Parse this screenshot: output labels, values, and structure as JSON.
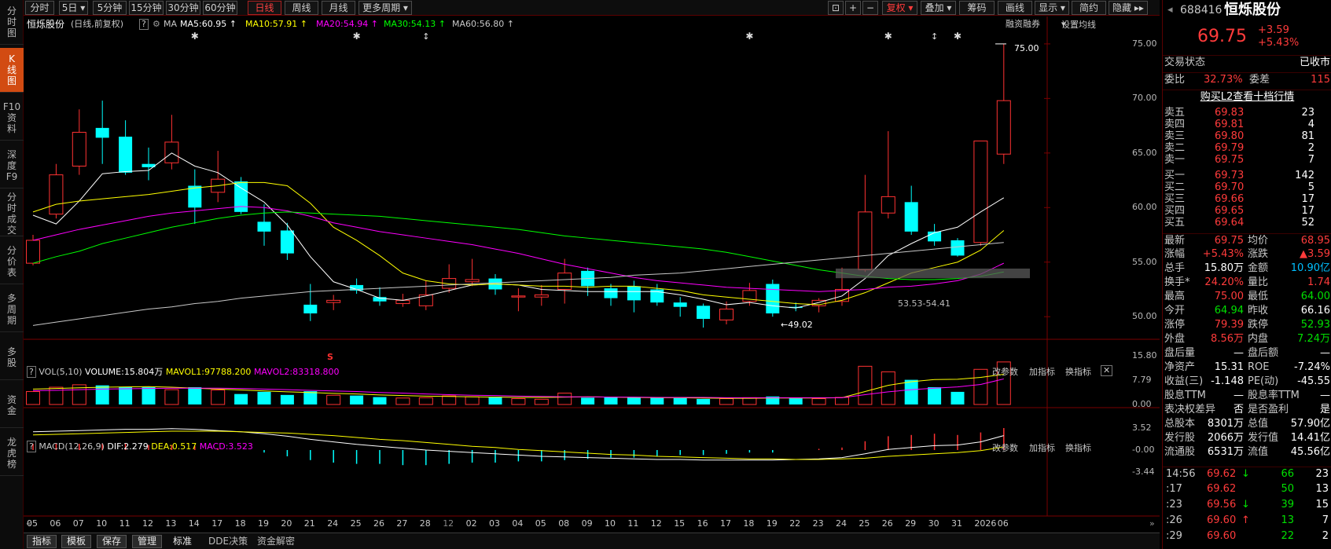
{
  "left_nav": [
    {
      "label": "分时图"
    },
    {
      "label": "K线图",
      "active": true
    },
    {
      "label": "F10资料"
    },
    {
      "label": "深度F9"
    },
    {
      "label": "分时成交"
    },
    {
      "label": "分价表"
    },
    {
      "label": "多周期"
    },
    {
      "label": "多股"
    },
    {
      "label": "资金"
    },
    {
      "label": "龙虎榜"
    }
  ],
  "toolbar": {
    "periods": [
      "分时",
      "5日",
      "5分钟",
      "15分钟",
      "30分钟",
      "60分钟",
      "日线",
      "周线",
      "月线",
      "更多周期"
    ],
    "active_period": "日线",
    "right_buttons": [
      "复权",
      "叠加",
      "筹码",
      "画线",
      "显示",
      "简约",
      "隐藏"
    ]
  },
  "title_bar": {
    "stock_name": "恒烁股份",
    "mode": "(日线,前复权)",
    "help": "?",
    "ma_label": "MA",
    "ma": [
      {
        "label": "MA5:60.95",
        "color": "#ffffff"
      },
      {
        "label": "MA10:57.91",
        "color": "#ffff00"
      },
      {
        "label": "MA20:54.94",
        "color": "#ff00ff"
      },
      {
        "label": "MA30:54.13",
        "color": "#00ff00"
      },
      {
        "label": "MA60:56.80",
        "color": "#c8c8c8"
      }
    ],
    "right_links": [
      "融资融券",
      "设置均线"
    ]
  },
  "price_axis": [
    "75.00",
    "70.00",
    "65.00",
    "60.00",
    "55.00",
    "50.00"
  ],
  "annotations": {
    "high": "75.00",
    "low": "49.02",
    "zone": "53.53-54.41",
    "s_marker": "S"
  },
  "vol_panel": {
    "title": "VOL(5,10)",
    "volume": "VOLUME:15.804万",
    "mavol1": "MAVOL1:97788.200",
    "mavol2": "MAVOL2:83318.800",
    "links": [
      "改参数",
      "加指标",
      "换指标"
    ],
    "axis": [
      "15.80",
      "7.79",
      "0.00"
    ]
  },
  "macd_panel": {
    "title": "MACD(12,26,9)",
    "dif": "DIF:2.279",
    "dea": "DEA:0.517",
    "macd": "MACD:3.523",
    "links": [
      "改参数",
      "加指标",
      "换指标"
    ],
    "axis": [
      "3.52",
      "-0.00",
      "-3.44"
    ]
  },
  "x_labels": [
    "05",
    "06",
    "07",
    "10",
    "11",
    "12",
    "13",
    "14",
    "17",
    "18",
    "19",
    "20",
    "21",
    "24",
    "25",
    "26",
    "27",
    "28",
    "12",
    "02",
    "03",
    "04",
    "05",
    "08",
    "09",
    "10",
    "11",
    "12",
    "15",
    "16",
    "17",
    "18",
    "19",
    "22",
    "23",
    "24",
    "25",
    "26",
    "29",
    "30",
    "31",
    "2026",
    "06"
  ],
  "bottom_tabs": [
    "指标",
    "模板",
    "保存",
    "管理",
    "标准",
    "DDE决策",
    "资金解密"
  ],
  "quote": {
    "code": "688416",
    "name": "恒烁股份",
    "price": "69.75",
    "change": "+3.59",
    "pct": "+5.43%",
    "status_label": "交易状态",
    "status": "已收市",
    "wei_bi_label": "委比",
    "wei_bi": "32.73%",
    "wei_cha_label": "委差",
    "wei_cha": "115",
    "l2_link": "购买L2查看十档行情",
    "asks": [
      {
        "label": "卖五",
        "price": "69.83",
        "vol": "23"
      },
      {
        "label": "卖四",
        "price": "69.81",
        "vol": "4"
      },
      {
        "label": "卖三",
        "price": "69.80",
        "vol": "81"
      },
      {
        "label": "卖二",
        "price": "69.79",
        "vol": "2"
      },
      {
        "label": "卖一",
        "price": "69.75",
        "vol": "7"
      }
    ],
    "bids": [
      {
        "label": "买一",
        "price": "69.73",
        "vol": "142"
      },
      {
        "label": "买二",
        "price": "69.70",
        "vol": "5"
      },
      {
        "label": "买三",
        "price": "69.66",
        "vol": "17"
      },
      {
        "label": "买四",
        "price": "69.65",
        "vol": "17"
      },
      {
        "label": "买五",
        "price": "69.64",
        "vol": "52"
      }
    ],
    "stats": [
      [
        "最新",
        "69.75",
        "均价",
        "68.95"
      ],
      [
        "涨幅",
        "+5.43%",
        "涨跌",
        "▲3.59"
      ],
      [
        "总手",
        "15.80万",
        "金额",
        "10.90亿"
      ],
      [
        "换手*",
        "24.20%",
        "量比",
        "1.74"
      ],
      [
        "最高",
        "75.00",
        "最低",
        "64.00"
      ],
      [
        "今开",
        "64.94",
        "昨收",
        "66.16"
      ],
      [
        "涨停",
        "79.39",
        "跌停",
        "52.93"
      ],
      [
        "外盘",
        "8.56万",
        "内盘",
        "7.24万"
      ],
      [
        "盘后量",
        "—",
        "盘后额",
        "—"
      ],
      [
        "净资产",
        "15.31",
        "ROE",
        "-7.24%"
      ],
      [
        "收益(三)",
        "-1.148",
        "PE(动)",
        "-45.55"
      ],
      [
        "股息TTM",
        "—",
        "股息率TTM",
        "—"
      ],
      [
        "表决权差异",
        "否",
        "是否盈利",
        "是"
      ],
      [
        "总股本",
        "8301万",
        "总值",
        "57.90亿"
      ],
      [
        "发行股",
        "2066万",
        "发行值",
        "14.41亿"
      ],
      [
        "流通股",
        "6531万",
        "流值",
        "45.56亿"
      ]
    ],
    "ticks": [
      {
        "time": "14:56",
        "price": "69.62",
        "arrow": "↓",
        "vol": "66",
        "num": "23"
      },
      {
        "time": ":17",
        "price": "69.62",
        "arrow": "",
        "vol": "50",
        "num": "13"
      },
      {
        "time": ":23",
        "price": "69.56",
        "arrow": "↓",
        "vol": "39",
        "num": "15"
      },
      {
        "time": ":26",
        "price": "69.60",
        "arrow": "↑",
        "vol": "13",
        "num": "7"
      },
      {
        "time": ":29",
        "price": "69.60",
        "arrow": "",
        "vol": "22",
        "num": "2"
      }
    ]
  },
  "chart_data": {
    "type": "candlestick",
    "ylim": [
      48,
      76
    ],
    "candles": [
      [
        54.9,
        57.0,
        57.5,
        54.7
      ],
      [
        59.4,
        63.0,
        64.0,
        59.0
      ],
      [
        63.8,
        66.9,
        69.0,
        63.0
      ],
      [
        67.3,
        66.4,
        69.8,
        64.0
      ],
      [
        66.5,
        63.2,
        68.0,
        63.0
      ],
      [
        64.0,
        63.7,
        65.5,
        62.5
      ],
      [
        64.1,
        66.0,
        68.5,
        63.5
      ],
      [
        62.0,
        60.0,
        63.5,
        58.5
      ],
      [
        61.4,
        62.6,
        65.2,
        60.5
      ],
      [
        62.4,
        59.6,
        62.8,
        59.4
      ],
      [
        58.7,
        57.8,
        60.3,
        56.5
      ],
      [
        57.9,
        55.8,
        58.6,
        55.2
      ],
      [
        51.1,
        50.3,
        53.0,
        49.6
      ],
      [
        51.3,
        51.5,
        52.0,
        50.6
      ],
      [
        52.9,
        52.4,
        53.5,
        52.1
      ],
      [
        51.8,
        51.4,
        52.7,
        51.0
      ],
      [
        51.2,
        51.5,
        52.1,
        50.9
      ],
      [
        51.0,
        52.0,
        53.3,
        50.6
      ],
      [
        52.6,
        53.5,
        54.8,
        52.2
      ],
      [
        53.2,
        53.4,
        55.3,
        52.8
      ],
      [
        53.5,
        52.5,
        53.9,
        52.0
      ],
      [
        51.8,
        51.9,
        52.6,
        50.5
      ],
      [
        51.8,
        52.0,
        52.9,
        51.0
      ],
      [
        52.5,
        54.0,
        55.3,
        51.2
      ],
      [
        54.2,
        52.8,
        54.5,
        51.9
      ],
      [
        52.6,
        51.7,
        53.0,
        51.0
      ],
      [
        52.8,
        51.5,
        53.3,
        50.4
      ],
      [
        52.5,
        51.3,
        53.0,
        51.0
      ],
      [
        51.3,
        50.9,
        51.8,
        50.0
      ],
      [
        51.0,
        49.8,
        51.2,
        49.0
      ],
      [
        49.7,
        50.7,
        51.4,
        49.3
      ],
      [
        51.4,
        52.4,
        53.1,
        51.0
      ],
      [
        53.0,
        50.3,
        53.4,
        50.0
      ],
      [
        50.9,
        50.8,
        51.3,
        50.5
      ],
      [
        51.0,
        51.5,
        51.7,
        50.4
      ],
      [
        51.4,
        52.5,
        54.5,
        51.0
      ],
      [
        54.3,
        59.6,
        63.0,
        54.1
      ],
      [
        59.5,
        61.0,
        67.0,
        59.0
      ],
      [
        60.5,
        57.8,
        62.0,
        57.5
      ],
      [
        57.8,
        56.9,
        58.5,
        56.5
      ],
      [
        57.0,
        55.6,
        57.2,
        55.5
      ],
      [
        56.8,
        66.1,
        66.1,
        56.5
      ],
      [
        64.9,
        69.8,
        75.0,
        64.0
      ]
    ],
    "ma": [
      {
        "name": "MA5",
        "color": "#ffffff",
        "values": [
          59.3,
          58.5,
          60.6,
          63.1,
          63.3,
          63.4,
          65.0,
          63.8,
          63.2,
          61.8,
          60.5,
          58.4,
          55.5,
          53.2,
          52.5,
          51.7,
          51.5,
          51.9,
          52.4,
          52.9,
          53.0,
          52.9,
          52.5,
          52.4,
          52.3,
          52.3,
          52.3,
          52.3,
          52.0,
          51.6,
          51.1,
          51.3,
          51.0,
          50.8,
          51.3,
          51.9,
          53.5,
          55.6,
          56.7,
          57.7,
          58.2,
          59.6,
          60.9
        ]
      },
      {
        "name": "MA10",
        "color": "#ffff00",
        "values": [
          59.6,
          60.3,
          60.6,
          60.8,
          61.0,
          61.2,
          61.5,
          61.8,
          62.0,
          62.3,
          62.3,
          62.0,
          60.4,
          58.2,
          57.0,
          55.6,
          54.0,
          53.3,
          53.0,
          52.9,
          53.0,
          52.9,
          52.8,
          52.8,
          52.7,
          52.8,
          52.8,
          52.6,
          52.4,
          52.0,
          51.8,
          51.6,
          51.4,
          51.2,
          51.1,
          51.5,
          52.2,
          53.1,
          54.0,
          54.5,
          55.0,
          56.1,
          57.9
        ]
      },
      {
        "name": "MA20",
        "color": "#ff00ff",
        "values": [
          57.0,
          57.5,
          58.0,
          58.4,
          58.8,
          59.2,
          59.5,
          59.7,
          59.9,
          60.1,
          60.0,
          59.7,
          59.2,
          58.6,
          58.2,
          57.8,
          57.5,
          57.2,
          56.9,
          56.6,
          56.2,
          55.8,
          55.3,
          54.8,
          54.4,
          54.0,
          53.6,
          53.3,
          53.1,
          52.9,
          52.7,
          52.6,
          52.5,
          52.4,
          52.3,
          52.4,
          52.5,
          52.7,
          52.8,
          53.0,
          53.3,
          53.9,
          54.9
        ]
      },
      {
        "name": "MA30",
        "color": "#00ff00",
        "values": [
          54.9,
          55.5,
          56.0,
          56.7,
          57.2,
          57.7,
          58.2,
          58.6,
          59.0,
          59.3,
          59.5,
          59.6,
          59.5,
          59.4,
          59.3,
          59.2,
          59.0,
          58.8,
          58.6,
          58.4,
          58.2,
          58.0,
          57.7,
          57.4,
          57.2,
          57.0,
          56.8,
          56.6,
          56.4,
          56.2,
          55.9,
          55.5,
          55.1,
          54.7,
          54.3,
          54.0,
          53.7,
          53.5,
          53.4,
          53.4,
          53.5,
          53.7,
          54.1
        ]
      },
      {
        "name": "MA60",
        "color": "#c8c8c8",
        "values": [
          49.2,
          49.5,
          49.8,
          50.1,
          50.4,
          50.7,
          50.9,
          51.2,
          51.4,
          51.7,
          51.9,
          52.1,
          52.3,
          52.4,
          52.5,
          52.6,
          52.7,
          52.8,
          52.9,
          53.0,
          53.1,
          53.2,
          53.3,
          53.4,
          53.5,
          53.6,
          53.8,
          53.9,
          54.0,
          54.2,
          54.4,
          54.6,
          54.8,
          55.0,
          55.2,
          55.4,
          55.6,
          55.8,
          56.0,
          56.2,
          56.4,
          56.6,
          56.8
        ]
      }
    ],
    "volume": [
      4.2,
      5.6,
      6.4,
      6.2,
      5.7,
      5.6,
      4.8,
      5.6,
      4.7,
      3.4,
      4.1,
      3.1,
      4.3,
      3.0,
      2.9,
      2.4,
      2.1,
      2.2,
      2.8,
      2.5,
      2.5,
      1.9,
      1.7,
      3.7,
      2.2,
      2.3,
      2.4,
      2.2,
      2.1,
      1.8,
      1.9,
      2.2,
      2.6,
      2.0,
      1.9,
      2.3,
      12.4,
      10.6,
      8.0,
      5.6,
      4.1,
      11.4,
      13.8
    ],
    "mavol1": [
      5.0,
      5.2,
      5.4,
      5.6,
      5.7,
      5.8,
      5.6,
      5.3,
      5.0,
      4.7,
      4.4,
      4.1,
      3.9,
      3.6,
      3.4,
      3.1,
      2.9,
      2.7,
      2.6,
      2.5,
      2.4,
      2.3,
      2.3,
      2.4,
      2.5,
      2.4,
      2.3,
      2.2,
      2.2,
      2.1,
      2.0,
      2.0,
      2.1,
      2.1,
      2.1,
      2.2,
      4.2,
      6.2,
      7.4,
      8.1,
      8.2,
      8.8,
      9.8
    ],
    "mavol2": [
      4.5,
      4.6,
      4.8,
      5.0,
      5.1,
      5.2,
      5.3,
      5.3,
      5.3,
      5.2,
      5.0,
      4.8,
      4.6,
      4.4,
      4.2,
      3.9,
      3.7,
      3.4,
      3.2,
      3.0,
      2.9,
      2.7,
      2.6,
      2.5,
      2.5,
      2.4,
      2.4,
      2.3,
      2.3,
      2.3,
      2.2,
      2.2,
      2.2,
      2.2,
      2.2,
      2.2,
      3.2,
      4.1,
      4.8,
      5.3,
      5.7,
      6.5,
      8.3
    ],
    "macd": {
      "dif": [
        2.9,
        3.0,
        3.1,
        3.2,
        3.3,
        3.3,
        3.4,
        3.3,
        3.1,
        2.9,
        2.6,
        2.2,
        1.7,
        1.3,
        0.9,
        0.6,
        0.3,
        0.0,
        -0.2,
        -0.4,
        -0.6,
        -0.8,
        -1.0,
        -1.1,
        -1.2,
        -1.3,
        -1.4,
        -1.5,
        -1.5,
        -1.6,
        -1.6,
        -1.6,
        -1.6,
        -1.5,
        -1.4,
        -1.2,
        -0.6,
        0.1,
        0.4,
        0.7,
        0.8,
        1.3,
        2.3
      ],
      "dea": [
        2.4,
        2.5,
        2.6,
        2.7,
        2.8,
        2.9,
        3.0,
        3.0,
        3.0,
        2.9,
        2.8,
        2.7,
        2.5,
        2.3,
        2.0,
        1.7,
        1.5,
        1.2,
        0.9,
        0.6,
        0.4,
        0.1,
        -0.1,
        -0.3,
        -0.5,
        -0.7,
        -0.8,
        -1.0,
        -1.1,
        -1.2,
        -1.3,
        -1.4,
        -1.4,
        -1.5,
        -1.5,
        -1.4,
        -1.3,
        -1.0,
        -0.8,
        -0.6,
        -0.4,
        -0.1,
        0.5
      ],
      "bar": [
        1.0,
        1.0,
        1.0,
        1.0,
        1.0,
        0.8,
        0.8,
        0.6,
        0.2,
        0.0,
        -0.4,
        -1.0,
        -1.6,
        -2.0,
        -2.2,
        -2.2,
        -2.4,
        -2.4,
        -2.2,
        -2.0,
        -2.0,
        -1.8,
        -1.8,
        -1.6,
        -1.4,
        -1.2,
        -1.2,
        -1.0,
        -0.8,
        -0.8,
        -0.6,
        -0.4,
        -0.4,
        0.0,
        0.2,
        0.4,
        1.4,
        2.2,
        2.4,
        2.6,
        2.4,
        2.8,
        3.5
      ]
    }
  }
}
